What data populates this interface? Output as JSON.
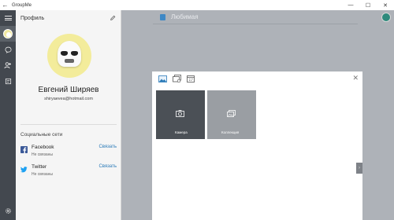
{
  "window": {
    "title": "GroupMe",
    "back_glyph": "←",
    "minimize_glyph": "—",
    "maximize_glyph": "☐",
    "close_glyph": "✕"
  },
  "profile": {
    "title": "Профиль",
    "name": "Евгений Ширяев",
    "email": "shiryaevea@hotmail.com",
    "social_title": "Социальные сети",
    "networks": [
      {
        "name": "Facebook",
        "status": "Не связаны",
        "action": "Связать",
        "color": "#3b5998"
      },
      {
        "name": "Twitter",
        "status": "Не связаны",
        "action": "Связать",
        "color": "#1da1f2"
      }
    ]
  },
  "chat": {
    "group_name": "Любимая"
  },
  "attach_dialog": {
    "close_glyph": "✕",
    "tiles": [
      {
        "label": "Камера"
      },
      {
        "label": "Коллекция"
      }
    ]
  },
  "colors": {
    "accent": "#2a7ab8",
    "rail": "#43484f",
    "background": "#aeb2b8"
  }
}
